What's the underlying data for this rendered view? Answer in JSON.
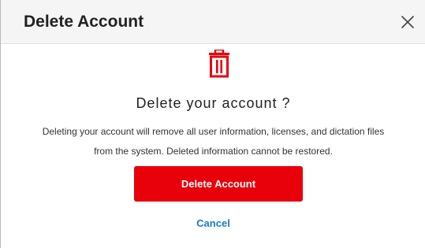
{
  "dialog": {
    "title": "Delete Account",
    "close_icon": "close-icon",
    "trash_icon": "trash-icon",
    "heading": "Delete your account ?",
    "description_line1": "Deleting your account will remove all user information, licenses, and dictation files",
    "description_line2": "from the system. Deleted information cannot be restored.",
    "delete_button_label": "Delete Account",
    "cancel_label": "Cancel"
  },
  "colors": {
    "danger": "#e8000b",
    "link": "#1a7cc4",
    "header_background": "#f5f5f5"
  }
}
